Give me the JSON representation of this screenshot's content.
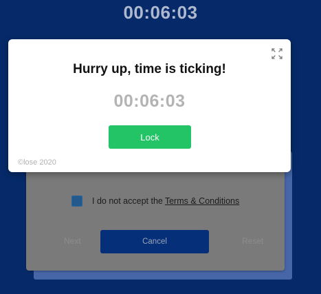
{
  "background": {
    "timer": "00:06:03",
    "form": {
      "checkbox_label": "I do not accept the",
      "terms_link": "Terms & Conditions",
      "next_label": "Next",
      "cancel_label": "Cancel",
      "reset_label": "Reset"
    }
  },
  "modal": {
    "title": "Hurry up, time is ticking!",
    "timer": "00:06:03",
    "lock_label": "Lock",
    "copyright": "©lose 2020",
    "expand_icon": "expand-icon"
  },
  "colors": {
    "page_background": "#062a69",
    "lock_button": "#22c465",
    "cancel_button": "#062f7a",
    "checkbox": "#23598d"
  }
}
